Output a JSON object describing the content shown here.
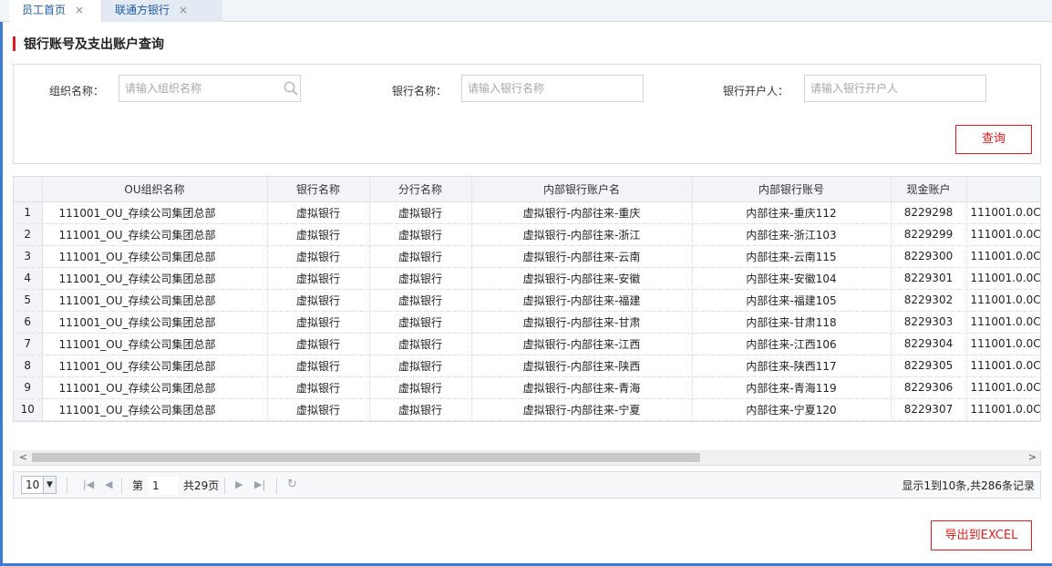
{
  "tabs": [
    {
      "label": "员工首页",
      "close": "×"
    },
    {
      "label": "联通方银行",
      "close": "×"
    }
  ],
  "page_title": "银行账号及支出账户查询",
  "filters": {
    "org": {
      "label": "组织名称：",
      "placeholder": "请输入组织名称"
    },
    "bank": {
      "label": "银行名称：",
      "placeholder": "请输入银行名称"
    },
    "holder": {
      "label": "银行开户人：",
      "placeholder": "请输入银行开户人"
    }
  },
  "query_button": "查询",
  "table": {
    "columns": [
      "OU组织名称",
      "银行名称",
      "分行名称",
      "内部银行账户名",
      "内部银行账号",
      "现金账户",
      ""
    ],
    "rows": [
      {
        "n": "1",
        "org": "111001_OU_存续公司集团总部",
        "bank": "虚拟银行",
        "branch": "虚拟银行",
        "acct_name": "虚拟银行-内部往来-重庆",
        "acct_no": "内部往来-重庆112",
        "cash": "8229298",
        "extra": "111001.0.0C"
      },
      {
        "n": "2",
        "org": "111001_OU_存续公司集团总部",
        "bank": "虚拟银行",
        "branch": "虚拟银行",
        "acct_name": "虚拟银行-内部往来-浙江",
        "acct_no": "内部往来-浙江103",
        "cash": "8229299",
        "extra": "111001.0.0C"
      },
      {
        "n": "3",
        "org": "111001_OU_存续公司集团总部",
        "bank": "虚拟银行",
        "branch": "虚拟银行",
        "acct_name": "虚拟银行-内部往来-云南",
        "acct_no": "内部往来-云南115",
        "cash": "8229300",
        "extra": "111001.0.0C"
      },
      {
        "n": "4",
        "org": "111001_OU_存续公司集团总部",
        "bank": "虚拟银行",
        "branch": "虚拟银行",
        "acct_name": "虚拟银行-内部往来-安徽",
        "acct_no": "内部往来-安徽104",
        "cash": "8229301",
        "extra": "111001.0.0C"
      },
      {
        "n": "5",
        "org": "111001_OU_存续公司集团总部",
        "bank": "虚拟银行",
        "branch": "虚拟银行",
        "acct_name": "虚拟银行-内部往来-福建",
        "acct_no": "内部往来-福建105",
        "cash": "8229302",
        "extra": "111001.0.0C"
      },
      {
        "n": "6",
        "org": "111001_OU_存续公司集团总部",
        "bank": "虚拟银行",
        "branch": "虚拟银行",
        "acct_name": "虚拟银行-内部往来-甘肃",
        "acct_no": "内部往来-甘肃118",
        "cash": "8229303",
        "extra": "111001.0.0C"
      },
      {
        "n": "7",
        "org": "111001_OU_存续公司集团总部",
        "bank": "虚拟银行",
        "branch": "虚拟银行",
        "acct_name": "虚拟银行-内部往来-江西",
        "acct_no": "内部往来-江西106",
        "cash": "8229304",
        "extra": "111001.0.0C"
      },
      {
        "n": "8",
        "org": "111001_OU_存续公司集团总部",
        "bank": "虚拟银行",
        "branch": "虚拟银行",
        "acct_name": "虚拟银行-内部往来-陕西",
        "acct_no": "内部往来-陕西117",
        "cash": "8229305",
        "extra": "111001.0.0C"
      },
      {
        "n": "9",
        "org": "111001_OU_存续公司集团总部",
        "bank": "虚拟银行",
        "branch": "虚拟银行",
        "acct_name": "虚拟银行-内部往来-青海",
        "acct_no": "内部往来-青海119",
        "cash": "8229306",
        "extra": "111001.0.0C"
      },
      {
        "n": "10",
        "org": "111001_OU_存续公司集团总部",
        "bank": "虚拟银行",
        "branch": "虚拟银行",
        "acct_name": "虚拟银行-内部往来-宁夏",
        "acct_no": "内部往来-宁夏120",
        "cash": "8229307",
        "extra": "111001.0.0C"
      }
    ]
  },
  "scroll": {
    "left": "<",
    "right": ">"
  },
  "pager": {
    "page_size": "10",
    "page_label": "第",
    "page_value": "1",
    "total_pages": "共29页",
    "info": "显示1到10条,共286条记录",
    "icons": {
      "first": "|◀",
      "prev": "◀",
      "next": "▶",
      "last": "▶|",
      "refresh": "↻"
    }
  },
  "export_button": "导出到EXCEL",
  "colors": {
    "accent_red": "#e21b1b",
    "frame_blue": "#3b7bd0",
    "tab_text": "#1a5ba8"
  }
}
